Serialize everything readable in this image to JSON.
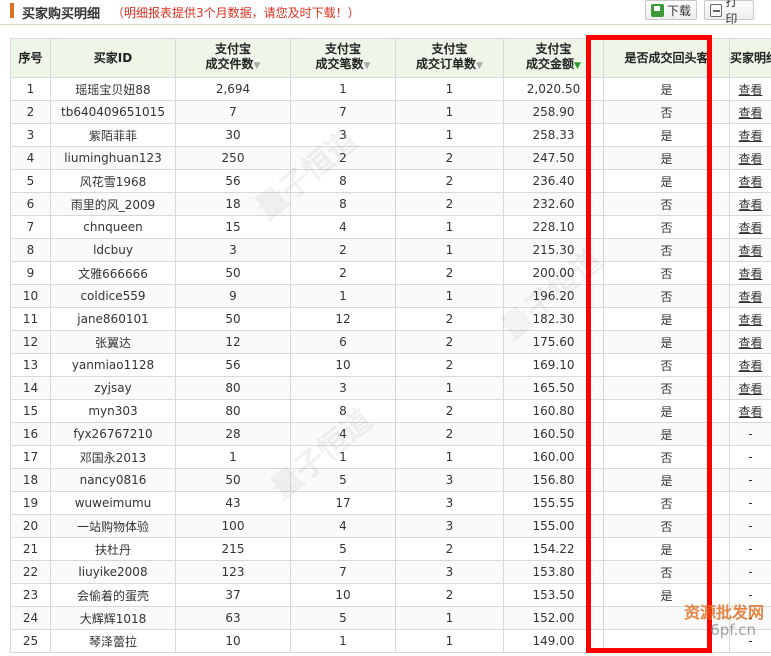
{
  "header": {
    "title": "买家购买明细",
    "notice": "（明细报表提供3个月数据，请您及时下载！）",
    "download_label": "下载",
    "print_label": "打印"
  },
  "columns": {
    "no": "序号",
    "buyer_id": "买家ID",
    "items_l1": "支付宝",
    "items_l2": "成交件数",
    "txns_l1": "支付宝",
    "txns_l2": "成交笔数",
    "orders_l1": "支付宝",
    "orders_l2": "成交订单数",
    "amount_l1": "支付宝",
    "amount_l2": "成交金额",
    "repeat": "是否成交回头客",
    "detail": "买家明细"
  },
  "rows": [
    {
      "no": "1",
      "id": "瑶瑶宝贝妞88",
      "items": "2,694",
      "txns": "1",
      "orders": "1",
      "amount": "2,020.50",
      "repeat": "是",
      "detail": "查看"
    },
    {
      "no": "2",
      "id": "tb640409651015",
      "items": "7",
      "txns": "7",
      "orders": "1",
      "amount": "258.90",
      "repeat": "否",
      "detail": "查看"
    },
    {
      "no": "3",
      "id": "紫陌菲菲",
      "items": "30",
      "txns": "3",
      "orders": "1",
      "amount": "258.33",
      "repeat": "是",
      "detail": "查看"
    },
    {
      "no": "4",
      "id": "liuminghuan123",
      "items": "250",
      "txns": "2",
      "orders": "2",
      "amount": "247.50",
      "repeat": "是",
      "detail": "查看"
    },
    {
      "no": "5",
      "id": "风花雪1968",
      "items": "56",
      "txns": "8",
      "orders": "2",
      "amount": "236.40",
      "repeat": "是",
      "detail": "查看"
    },
    {
      "no": "6",
      "id": "雨里的风_2009",
      "items": "18",
      "txns": "8",
      "orders": "2",
      "amount": "232.60",
      "repeat": "否",
      "detail": "查看"
    },
    {
      "no": "7",
      "id": "chnqueen",
      "items": "15",
      "txns": "4",
      "orders": "1",
      "amount": "228.10",
      "repeat": "否",
      "detail": "查看"
    },
    {
      "no": "8",
      "id": "ldcbuy",
      "items": "3",
      "txns": "2",
      "orders": "1",
      "amount": "215.30",
      "repeat": "否",
      "detail": "查看"
    },
    {
      "no": "9",
      "id": "文雅666666",
      "items": "50",
      "txns": "2",
      "orders": "2",
      "amount": "200.00",
      "repeat": "否",
      "detail": "查看"
    },
    {
      "no": "10",
      "id": "coldice559",
      "items": "9",
      "txns": "1",
      "orders": "1",
      "amount": "196.20",
      "repeat": "否",
      "detail": "查看"
    },
    {
      "no": "11",
      "id": "jane860101",
      "items": "50",
      "txns": "12",
      "orders": "2",
      "amount": "182.30",
      "repeat": "是",
      "detail": "查看"
    },
    {
      "no": "12",
      "id": "张翼达",
      "items": "12",
      "txns": "6",
      "orders": "2",
      "amount": "175.60",
      "repeat": "是",
      "detail": "查看"
    },
    {
      "no": "13",
      "id": "yanmiao1128",
      "items": "56",
      "txns": "10",
      "orders": "2",
      "amount": "169.10",
      "repeat": "否",
      "detail": "查看"
    },
    {
      "no": "14",
      "id": "zyjsay",
      "items": "80",
      "txns": "3",
      "orders": "1",
      "amount": "165.50",
      "repeat": "否",
      "detail": "查看"
    },
    {
      "no": "15",
      "id": "myn303",
      "items": "80",
      "txns": "8",
      "orders": "2",
      "amount": "160.80",
      "repeat": "是",
      "detail": "查看"
    },
    {
      "no": "16",
      "id": "fyx26767210",
      "items": "28",
      "txns": "4",
      "orders": "2",
      "amount": "160.50",
      "repeat": "是",
      "detail": "-"
    },
    {
      "no": "17",
      "id": "邓国永2013",
      "items": "1",
      "txns": "1",
      "orders": "1",
      "amount": "160.00",
      "repeat": "否",
      "detail": "-"
    },
    {
      "no": "18",
      "id": "nancy0816",
      "items": "50",
      "txns": "5",
      "orders": "3",
      "amount": "156.80",
      "repeat": "是",
      "detail": "-"
    },
    {
      "no": "19",
      "id": "wuweimumu",
      "items": "43",
      "txns": "17",
      "orders": "3",
      "amount": "155.55",
      "repeat": "否",
      "detail": "-"
    },
    {
      "no": "20",
      "id": "一站购物体验",
      "items": "100",
      "txns": "4",
      "orders": "3",
      "amount": "155.00",
      "repeat": "否",
      "detail": "-"
    },
    {
      "no": "21",
      "id": "扶杜丹",
      "items": "215",
      "txns": "5",
      "orders": "2",
      "amount": "154.22",
      "repeat": "是",
      "detail": "-"
    },
    {
      "no": "22",
      "id": "liuyike2008",
      "items": "123",
      "txns": "7",
      "orders": "3",
      "amount": "153.80",
      "repeat": "否",
      "detail": "-"
    },
    {
      "no": "23",
      "id": "会偷着的蛋壳",
      "items": "37",
      "txns": "10",
      "orders": "2",
      "amount": "153.50",
      "repeat": "是",
      "detail": "-"
    },
    {
      "no": "24",
      "id": "大辉辉1018",
      "items": "63",
      "txns": "5",
      "orders": "1",
      "amount": "152.00",
      "repeat": "",
      "detail": "-"
    },
    {
      "no": "25",
      "id": "琴泽蕾拉",
      "items": "10",
      "txns": "1",
      "orders": "1",
      "amount": "149.00",
      "repeat": "",
      "detail": "-"
    }
  ],
  "icons": {
    "download": "download-icon",
    "print": "printer-icon",
    "sort": "sort-arrow-icon"
  },
  "colors": {
    "notice": "#e03020",
    "header_bg": "#eef6e8",
    "highlight": "#ff0000",
    "active_sort": "#2a9a2a"
  },
  "watermark": {
    "text": "量子恒道",
    "corner_l1": "资源批发网",
    "corner_l2": "6pf.cn"
  }
}
